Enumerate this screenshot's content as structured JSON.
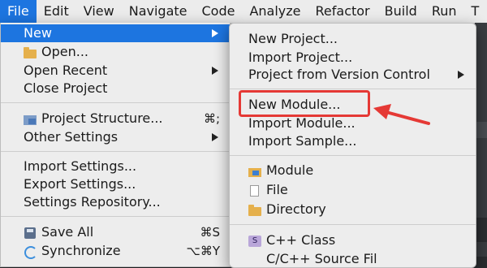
{
  "menubar": [
    "File",
    "Edit",
    "View",
    "Navigate",
    "Code",
    "Analyze",
    "Refactor",
    "Build",
    "Run",
    "T"
  ],
  "file_menu": {
    "new": "New",
    "open": "Open...",
    "open_recent": "Open Recent",
    "close_project": "Close Project",
    "project_structure": "Project Structure...",
    "project_structure_sc": "⌘;",
    "other_settings": "Other Settings",
    "import_settings": "Import Settings...",
    "export_settings": "Export Settings...",
    "settings_repository": "Settings Repository...",
    "save_all": "Save All",
    "save_all_sc": "⌘S",
    "synchronize": "Synchronize",
    "synchronize_sc": "⌥⌘Y"
  },
  "new_submenu": {
    "new_project": "New Project...",
    "import_project": "Import Project...",
    "project_from_vcs": "Project from Version Control",
    "new_module": "New Module...",
    "import_module": "Import Module...",
    "import_sample": "Import Sample...",
    "module": "Module",
    "file": "File",
    "directory": "Directory",
    "cpp_class": "C++ Class",
    "cpp_icon_text": "S",
    "cut_off": "C/C++ Source Fil"
  },
  "colors": {
    "highlight": "#1d75e0",
    "annotation": "#e53935",
    "menu_bg": "#ededed"
  },
  "icons": [
    "folder-icon",
    "project-structure-icon",
    "save-icon",
    "synchronize-icon",
    "module-icon",
    "file-icon",
    "directory-icon",
    "cpp-class-icon",
    "submenu-arrow-icon"
  ]
}
